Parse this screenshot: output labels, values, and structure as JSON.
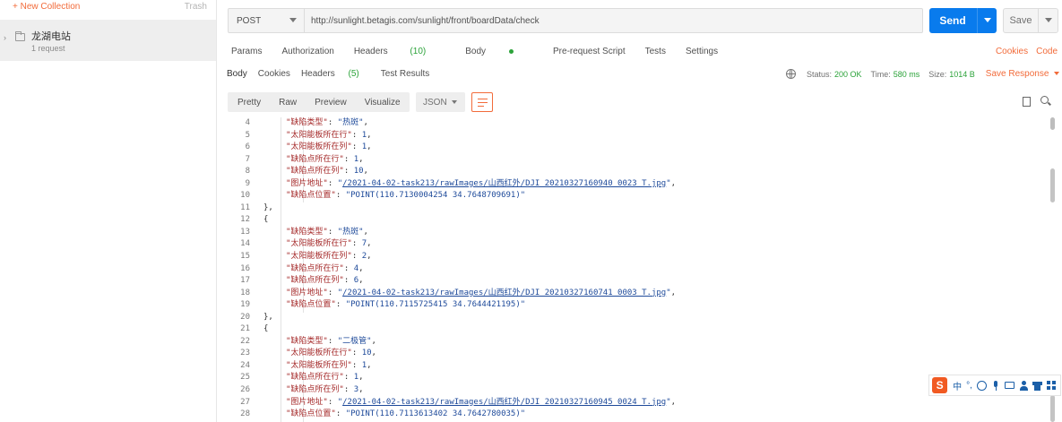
{
  "sidebar": {
    "new_collection": "+ New Collection",
    "trash": "Trash",
    "collection": {
      "name": "龙湖电站",
      "count": "1 request"
    }
  },
  "request": {
    "method": "POST",
    "url": "http://sunlight.betagis.com/sunlight/front/boardData/check",
    "send_label": "Send",
    "save_label": "Save",
    "tabs": {
      "params": "Params",
      "authorization": "Authorization",
      "headers": "Headers",
      "headers_count": "(10)",
      "body": "Body",
      "prerequest": "Pre-request Script",
      "tests": "Tests",
      "settings": "Settings"
    },
    "cookies_link": "Cookies",
    "code_link": "Code"
  },
  "response": {
    "tabs": {
      "body": "Body",
      "cookies": "Cookies",
      "headers": "Headers",
      "headers_count": "(5)",
      "test_results": "Test Results"
    },
    "status_label": "Status:",
    "status_value": "200 OK",
    "time_label": "Time:",
    "time_value": "580 ms",
    "size_label": "Size:",
    "size_value": "1014 B",
    "save_response": "Save Response",
    "format": {
      "pretty": "Pretty",
      "raw": "Raw",
      "preview": "Preview",
      "visualize": "Visualize",
      "type": "JSON"
    }
  },
  "code_lines": [
    {
      "n": "4",
      "indent": 3,
      "parts": [
        [
          "key",
          "\"缺陷类型\""
        ],
        [
          "p",
          ": "
        ],
        [
          "str",
          "\"热斑\""
        ],
        [
          "p",
          ","
        ]
      ]
    },
    {
      "n": "5",
      "indent": 3,
      "parts": [
        [
          "key",
          "\"太阳能板所在行\""
        ],
        [
          "p",
          ": "
        ],
        [
          "num",
          "1"
        ],
        [
          "p",
          ","
        ]
      ]
    },
    {
      "n": "6",
      "indent": 3,
      "parts": [
        [
          "key",
          "\"太阳能板所在列\""
        ],
        [
          "p",
          ": "
        ],
        [
          "num",
          "1"
        ],
        [
          "p",
          ","
        ]
      ]
    },
    {
      "n": "7",
      "indent": 3,
      "parts": [
        [
          "key",
          "\"缺陷点所在行\""
        ],
        [
          "p",
          ": "
        ],
        [
          "num",
          "1"
        ],
        [
          "p",
          ","
        ]
      ]
    },
    {
      "n": "8",
      "indent": 3,
      "parts": [
        [
          "key",
          "\"缺陷点所在列\""
        ],
        [
          "p",
          ": "
        ],
        [
          "num",
          "10"
        ],
        [
          "p",
          ","
        ]
      ]
    },
    {
      "n": "9",
      "indent": 3,
      "parts": [
        [
          "key",
          "\"图片地址\""
        ],
        [
          "p",
          ": "
        ],
        [
          "str",
          "\""
        ],
        [
          "lnk",
          "/2021-04-02-task213/rawImages/山西红外/DJI_20210327160940_0023_T.jpg"
        ],
        [
          "str",
          "\""
        ],
        [
          "p",
          ","
        ]
      ]
    },
    {
      "n": "10",
      "indent": 3,
      "parts": [
        [
          "key",
          "\"缺陷点位置\""
        ],
        [
          "p",
          ": "
        ],
        [
          "str",
          "\"POINT(110.7130004254 34.7648709691)\""
        ]
      ]
    },
    {
      "n": "11",
      "indent": 2,
      "parts": [
        [
          "p",
          "},"
        ]
      ]
    },
    {
      "n": "12",
      "indent": 2,
      "parts": [
        [
          "p",
          "{"
        ]
      ]
    },
    {
      "n": "13",
      "indent": 3,
      "parts": [
        [
          "key",
          "\"缺陷类型\""
        ],
        [
          "p",
          ": "
        ],
        [
          "str",
          "\"热斑\""
        ],
        [
          "p",
          ","
        ]
      ]
    },
    {
      "n": "14",
      "indent": 3,
      "parts": [
        [
          "key",
          "\"太阳能板所在行\""
        ],
        [
          "p",
          ": "
        ],
        [
          "num",
          "7"
        ],
        [
          "p",
          ","
        ]
      ]
    },
    {
      "n": "15",
      "indent": 3,
      "parts": [
        [
          "key",
          "\"太阳能板所在列\""
        ],
        [
          "p",
          ": "
        ],
        [
          "num",
          "2"
        ],
        [
          "p",
          ","
        ]
      ]
    },
    {
      "n": "16",
      "indent": 3,
      "parts": [
        [
          "key",
          "\"缺陷点所在行\""
        ],
        [
          "p",
          ": "
        ],
        [
          "num",
          "4"
        ],
        [
          "p",
          ","
        ]
      ]
    },
    {
      "n": "17",
      "indent": 3,
      "parts": [
        [
          "key",
          "\"缺陷点所在列\""
        ],
        [
          "p",
          ": "
        ],
        [
          "num",
          "6"
        ],
        [
          "p",
          ","
        ]
      ]
    },
    {
      "n": "18",
      "indent": 3,
      "parts": [
        [
          "key",
          "\"图片地址\""
        ],
        [
          "p",
          ": "
        ],
        [
          "str",
          "\""
        ],
        [
          "lnk",
          "/2021-04-02-task213/rawImages/山西红外/DJI_20210327160741_0003_T.jpg"
        ],
        [
          "str",
          "\""
        ],
        [
          "p",
          ","
        ]
      ]
    },
    {
      "n": "19",
      "indent": 3,
      "parts": [
        [
          "key",
          "\"缺陷点位置\""
        ],
        [
          "p",
          ": "
        ],
        [
          "str",
          "\"POINT(110.7115725415 34.7644421195)\""
        ]
      ]
    },
    {
      "n": "20",
      "indent": 2,
      "parts": [
        [
          "p",
          "},"
        ]
      ]
    },
    {
      "n": "21",
      "indent": 2,
      "parts": [
        [
          "p",
          "{"
        ]
      ]
    },
    {
      "n": "22",
      "indent": 3,
      "parts": [
        [
          "key",
          "\"缺陷类型\""
        ],
        [
          "p",
          ": "
        ],
        [
          "str",
          "\"二极管\""
        ],
        [
          "p",
          ","
        ]
      ]
    },
    {
      "n": "23",
      "indent": 3,
      "parts": [
        [
          "key",
          "\"太阳能板所在行\""
        ],
        [
          "p",
          ": "
        ],
        [
          "num",
          "10"
        ],
        [
          "p",
          ","
        ]
      ]
    },
    {
      "n": "24",
      "indent": 3,
      "parts": [
        [
          "key",
          "\"太阳能板所在列\""
        ],
        [
          "p",
          ": "
        ],
        [
          "num",
          "1"
        ],
        [
          "p",
          ","
        ]
      ]
    },
    {
      "n": "25",
      "indent": 3,
      "parts": [
        [
          "key",
          "\"缺陷点所在行\""
        ],
        [
          "p",
          ": "
        ],
        [
          "num",
          "1"
        ],
        [
          "p",
          ","
        ]
      ]
    },
    {
      "n": "26",
      "indent": 3,
      "parts": [
        [
          "key",
          "\"缺陷点所在列\""
        ],
        [
          "p",
          ": "
        ],
        [
          "num",
          "3"
        ],
        [
          "p",
          ","
        ]
      ]
    },
    {
      "n": "27",
      "indent": 3,
      "parts": [
        [
          "key",
          "\"图片地址\""
        ],
        [
          "p",
          ": "
        ],
        [
          "str",
          "\""
        ],
        [
          "lnk",
          "/2021-04-02-task213/rawImages/山西红外/DJI_20210327160945_0024_T.jpg"
        ],
        [
          "str",
          "\""
        ],
        [
          "p",
          ","
        ]
      ]
    },
    {
      "n": "28",
      "indent": 3,
      "parts": [
        [
          "key",
          "\"缺陷点位置\""
        ],
        [
          "p",
          ": "
        ],
        [
          "str",
          "\"POINT(110.7113613402 34.7642780035)\""
        ]
      ]
    }
  ],
  "ime": {
    "logo": "S",
    "lang": "中",
    "punct": "°,"
  },
  "colors": {
    "accent": "#f26b3a",
    "send": "#097bed",
    "ok": "#2ca33a",
    "json_key": "#a52a2a",
    "json_value": "#1e4a9a"
  },
  "icons": [
    "plus-icon",
    "folder-icon",
    "chevron-right-icon",
    "caret-down-icon",
    "globe-icon",
    "wrap-lines-icon",
    "copy-icon",
    "search-icon"
  ]
}
